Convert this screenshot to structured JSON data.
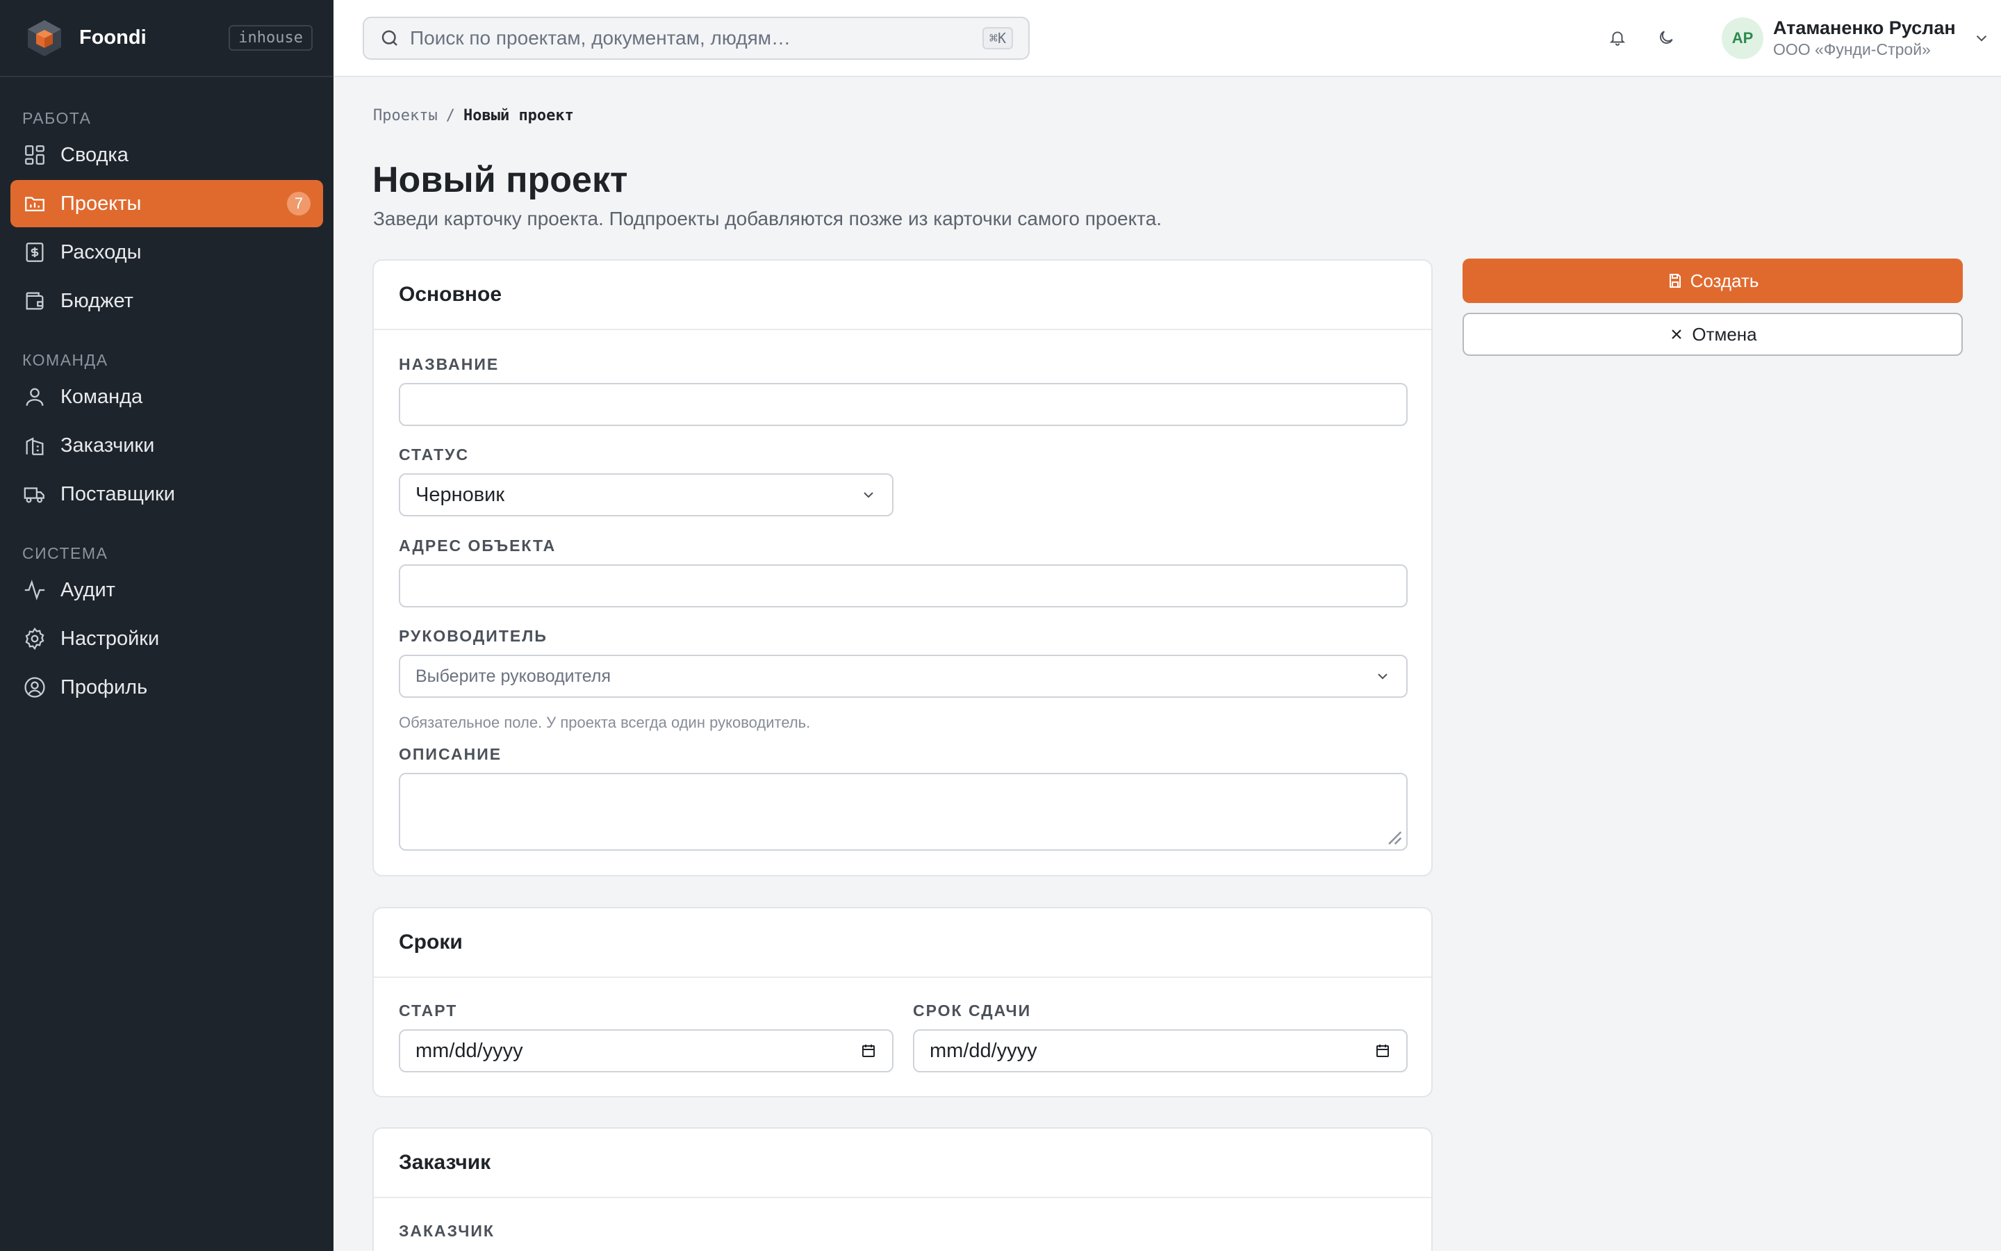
{
  "brand": {
    "name": "Foondi",
    "tag": "inhouse"
  },
  "sidebar": {
    "sections": [
      {
        "title": "РАБОТА",
        "items": [
          {
            "label": "Сводка",
            "icon": "dashboard-icon"
          },
          {
            "label": "Проекты",
            "icon": "projects-icon",
            "badge": "7",
            "active": true
          },
          {
            "label": "Расходы",
            "icon": "receipt-icon"
          },
          {
            "label": "Бюджет",
            "icon": "wallet-icon"
          }
        ]
      },
      {
        "title": "КОМАНДА",
        "items": [
          {
            "label": "Команда",
            "icon": "user-icon"
          },
          {
            "label": "Заказчики",
            "icon": "building-icon"
          },
          {
            "label": "Поставщики",
            "icon": "truck-icon"
          }
        ]
      },
      {
        "title": "СИСТЕМА",
        "items": [
          {
            "label": "Аудит",
            "icon": "activity-icon"
          },
          {
            "label": "Настройки",
            "icon": "gear-icon"
          },
          {
            "label": "Профиль",
            "icon": "profile-icon"
          }
        ]
      }
    ]
  },
  "topbar": {
    "search_placeholder": "Поиск по проектам, документам, людям…",
    "search_shortcut": "⌘K",
    "user": {
      "initials": "АР",
      "name": "Атаманенко Руслан",
      "org": "ООО «Фунди-Строй»"
    }
  },
  "breadcrumb": {
    "parent": "Проекты",
    "separator": "/",
    "current": "Новый проект"
  },
  "page": {
    "title": "Новый проект",
    "subtitle": "Заведи карточку проекта. Подпроекты добавляются позже из карточки самого проекта."
  },
  "cards": {
    "basic": {
      "title": "Основное",
      "name_label": "НАЗВАНИЕ",
      "name_value": "",
      "status_label": "СТАТУС",
      "status_value": "Черновик",
      "address_label": "АДРЕС ОБЪЕКТА",
      "address_value": "",
      "manager_label": "РУКОВОДИТЕЛЬ",
      "manager_placeholder": "Выберите руководителя",
      "manager_hint": "Обязательное поле. У проекта всегда один руководитель.",
      "description_label": "ОПИСАНИЕ",
      "description_value": ""
    },
    "dates": {
      "title": "Сроки",
      "start_label": "СТАРТ",
      "start_value": "mm/dd/yyyy",
      "due_label": "СРОК СДАЧИ",
      "due_value": "mm/dd/yyyy"
    },
    "customer": {
      "title": "Заказчик",
      "customer_label": "ЗАКАЗЧИК"
    }
  },
  "actions": {
    "create": "Создать",
    "cancel": "Отмена"
  },
  "colors": {
    "accent": "#e06a2e",
    "sidebar_bg": "#1e242c",
    "page_bg": "#f3f4f6"
  }
}
